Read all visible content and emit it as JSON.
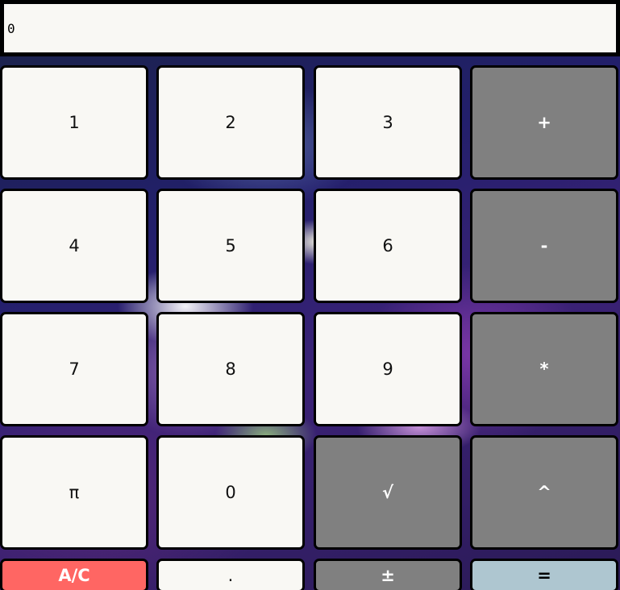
{
  "display": {
    "value": "0"
  },
  "keys": {
    "one": "1",
    "two": "2",
    "three": "3",
    "plus": "+",
    "four": "4",
    "five": "5",
    "six": "6",
    "minus": "-",
    "seven": "7",
    "eight": "8",
    "nine": "9",
    "multiply": "*",
    "pi": "π",
    "zero": "0",
    "sqrt": "√",
    "power": "^",
    "clear": "A/C",
    "decimal": ".",
    "negate": "±",
    "equals": "="
  },
  "colors": {
    "display_bg": "#f9f8f4",
    "number_key_bg": "#f9f8f4",
    "operator_key_bg": "#808080",
    "clear_key_bg": "#ff6663",
    "equals_key_bg": "#aec6d0"
  }
}
